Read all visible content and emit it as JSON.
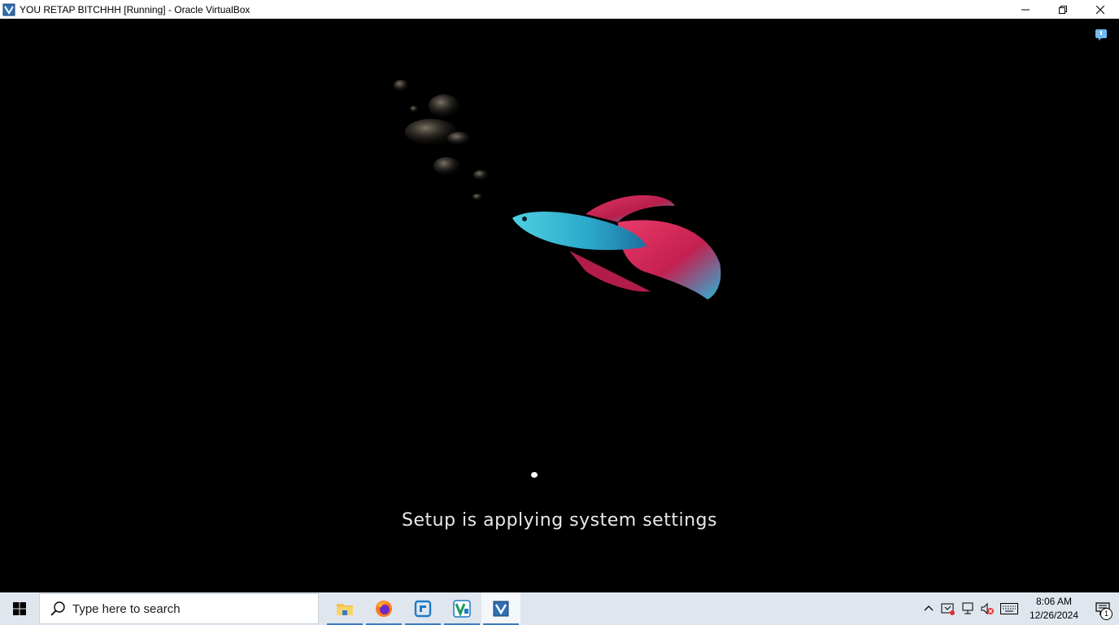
{
  "window": {
    "title": "YOU RETAP BITCHHH [Running] - Oracle VirtualBox",
    "app_icon": "virtualbox-icon",
    "controls": [
      "minimize-icon",
      "restore-icon",
      "close-icon"
    ]
  },
  "vm": {
    "setup_message": "Setup is applying system settings",
    "indicator_icon": "mouse-integration-icon"
  },
  "taskbar": {
    "start_icon": "windows-logo-icon",
    "search_placeholder": "Type here to search",
    "pinned_apps": [
      {
        "name": "file-explorer-icon",
        "running": true
      },
      {
        "name": "firefox-icon",
        "running": true
      },
      {
        "name": "app-blue-icon",
        "running": true
      },
      {
        "name": "app-green-icon",
        "running": true
      },
      {
        "name": "virtualbox-icon",
        "running": true,
        "active": true
      }
    ],
    "tray": {
      "icons": [
        "chevron-up-icon",
        "security-icon",
        "network-icon",
        "volume-muted-icon",
        "keyboard-icon"
      ],
      "time": "8:06 AM",
      "date": "12/26/2024",
      "notification_count": "1"
    }
  },
  "colors": {
    "taskbar_bg": "#dfe6ee",
    "accent": "#3a7cc1",
    "screen_bg": "#000000"
  }
}
